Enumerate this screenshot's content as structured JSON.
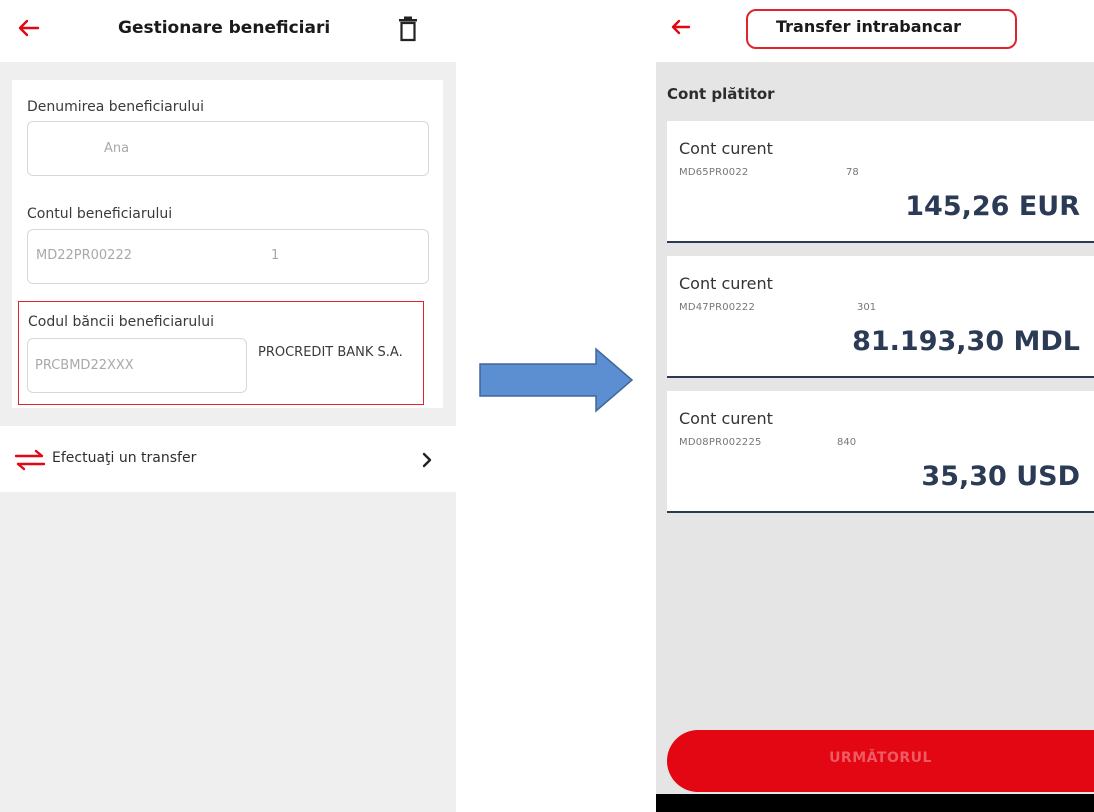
{
  "left_screen": {
    "header": {
      "title": "Gestionare beneficiari",
      "back_icon": "arrow-left-icon",
      "delete_icon": "trash-icon"
    },
    "form": {
      "name_label": "Denumirea beneficiarului",
      "name_value": "Ana",
      "account_label": "Contul beneficiarului",
      "account_value": "MD22PR00222",
      "account_value_suffix": "1",
      "bank_code_label": "Codul băncii beneficiarului",
      "bank_code_value": "PRCBMD22XXX",
      "bank_name": "PROCREDIT BANK S.A."
    },
    "action_row": {
      "label": "Efectuaţi un transfer",
      "icon": "transfer-arrows-icon",
      "chevron": "chevron-right-icon"
    }
  },
  "right_screen": {
    "header": {
      "title": "Transfer intrabancar",
      "back_icon": "arrow-left-icon"
    },
    "section_title": "Cont plătitor",
    "accounts": [
      {
        "name": "Cont curent",
        "iban": "MD65PR0022",
        "iban_suffix": "78",
        "amount": "145,26 EUR"
      },
      {
        "name": "Cont curent",
        "iban": "MD47PR00222",
        "iban_suffix": "301",
        "amount": "81.193,30 MDL"
      },
      {
        "name": "Cont curent",
        "iban": "MD08PR002225",
        "iban_suffix": "840",
        "amount": "35,30 USD"
      }
    ],
    "next_button": "URMĂTORUL"
  },
  "colors": {
    "accent_red": "#e30613",
    "navy": "#2b3a55",
    "arrow_blue": "#5b8fd1"
  }
}
